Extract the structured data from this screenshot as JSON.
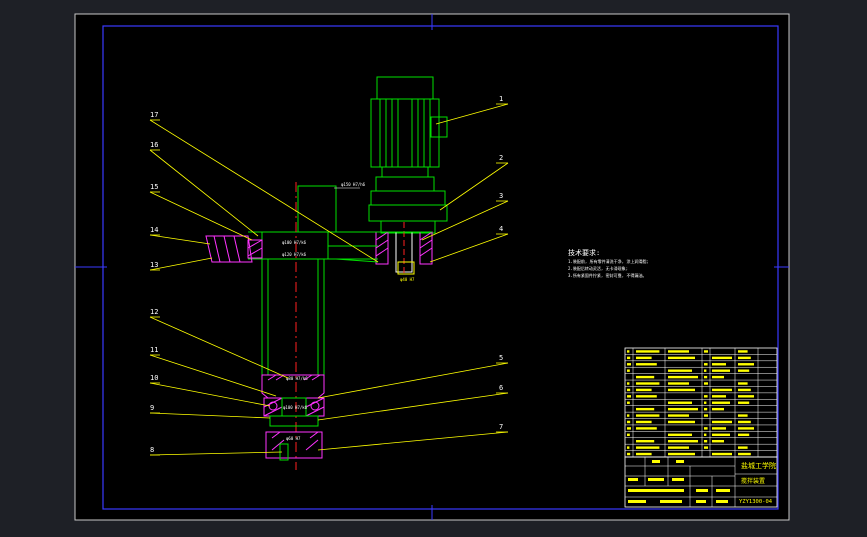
{
  "drawing": {
    "balloons": {
      "b1": "1",
      "b2": "2",
      "b3": "3",
      "b4": "4",
      "b5": "5",
      "b6": "6",
      "b7": "7",
      "b8": "8",
      "b9": "9",
      "b10": "10",
      "b11": "11",
      "b12": "12",
      "b13": "13",
      "b14": "14",
      "b15": "15",
      "b16": "16",
      "b17": "17"
    },
    "dims": {
      "top": "φ150 H7/h6",
      "shaft_upper1": "φ100 H7/k6",
      "shaft_upper2": "φ120 H7/k6",
      "lower": "φ80 H7/k6",
      "bearing": "φ100 H7/k6",
      "bottom": "φ60 H7",
      "key": "φ40 H7"
    },
    "notes": {
      "title": "技术要求:",
      "line1": "1.装配前, 所有零件清洗干净, 涂上润滑脂;",
      "line2": "2.装配后转动灵活, 无卡滞现象;",
      "line3": "3.所有紧固件拧紧, 密封可靠, 不得漏油。"
    },
    "titleblock": {
      "school": "盐城工学院",
      "drawing_name": "搅拌装置",
      "drawing_no": "YZY1300-04"
    }
  }
}
